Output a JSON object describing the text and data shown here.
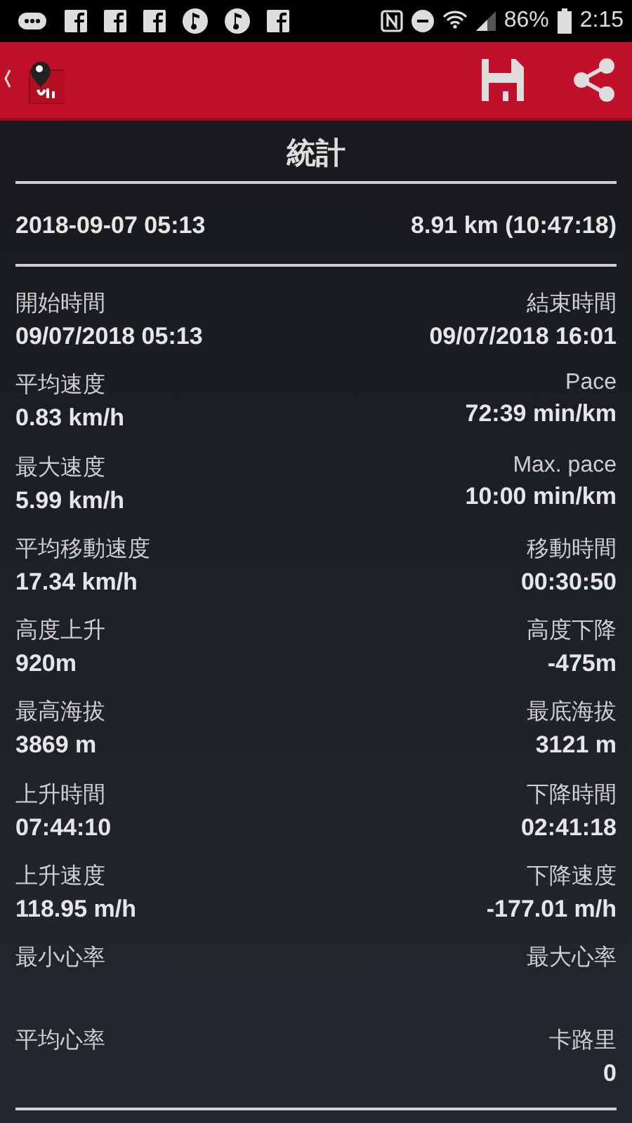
{
  "status_bar": {
    "battery": "86%",
    "time": "2:15"
  },
  "title": "統計",
  "summary": {
    "date": "2018-09-07 05:13",
    "distance": "8.91 km (10:47:18)"
  },
  "stats": [
    {
      "left": {
        "label": "開始時間",
        "value": "09/07/2018 05:13"
      },
      "right": {
        "label": "結束時間",
        "value": "09/07/2018 16:01"
      }
    },
    {
      "left": {
        "label": "平均速度",
        "value": "0.83 km/h"
      },
      "right": {
        "label": "Pace",
        "value": "72:39 min/km"
      }
    },
    {
      "left": {
        "label": "最大速度",
        "value": "5.99 km/h"
      },
      "right": {
        "label": "Max. pace",
        "value": "10:00 min/km"
      }
    },
    {
      "left": {
        "label": "平均移動速度",
        "value": "17.34 km/h"
      },
      "right": {
        "label": "移動時間",
        "value": "00:30:50"
      }
    },
    {
      "left": {
        "label": "高度上升",
        "value": "920m"
      },
      "right": {
        "label": "高度下降",
        "value": "-475m"
      }
    },
    {
      "left": {
        "label": "最高海拔",
        "value": "3869 m"
      },
      "right": {
        "label": "最底海拔",
        "value": "3121 m"
      }
    },
    {
      "left": {
        "label": "上升時間",
        "value": "07:44:10"
      },
      "right": {
        "label": "下降時間",
        "value": "02:41:18"
      }
    },
    {
      "left": {
        "label": "上升速度",
        "value": "118.95 m/h"
      },
      "right": {
        "label": "下降速度",
        "value": "-177.01 m/h"
      }
    },
    {
      "left": {
        "label": "最小心率"
      },
      "right": {
        "label": "最大心率"
      }
    },
    {
      "left": {
        "label": "平均心率"
      },
      "right": {
        "label": "卡路里",
        "value": "0"
      }
    }
  ]
}
